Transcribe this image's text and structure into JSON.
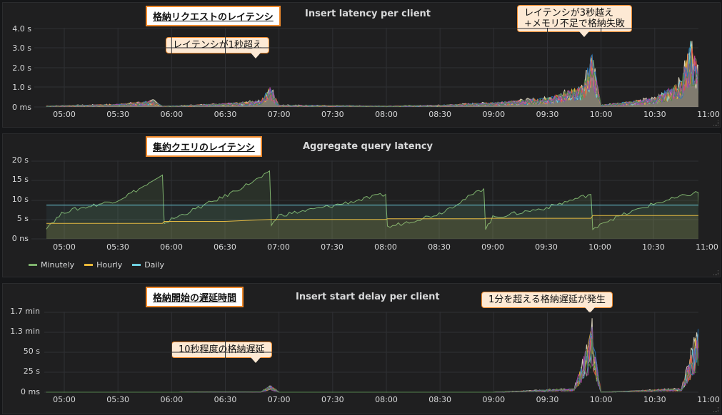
{
  "panels": [
    {
      "title": "Insert latency per client",
      "jp_label": "格納リクエストのレイテンシ",
      "callouts": [
        "レイテンシが1秒超え",
        "レイテンシが3秒越え\n+メモリ不足で格納失敗"
      ],
      "y_ticks": [
        "4.0 s",
        "3.0 s",
        "2.0 s",
        "1.0 s",
        "0 ms"
      ]
    },
    {
      "title": "Aggregate query latency",
      "jp_label": "集約クエリのレイテンシ",
      "y_ticks": [
        "20 s",
        "15 s",
        "10 s",
        "5 s",
        "0 ns"
      ]
    },
    {
      "title": "Insert start delay per client",
      "jp_label": "格納開始の遅延時間",
      "callouts": [
        "10秒程度の格納遅延",
        "1分を超える格納遅延が発生"
      ],
      "y_ticks": [
        "1.7 min",
        "1.3 min",
        "50 s",
        "25 s",
        "0 ms"
      ]
    }
  ],
  "x_ticks": [
    "05:00",
    "05:30",
    "06:00",
    "06:30",
    "07:00",
    "07:30",
    "08:00",
    "08:30",
    "09:00",
    "09:30",
    "10:00",
    "10:30",
    "11:00"
  ],
  "colors": {
    "minutely": "#7eb26d",
    "hourly": "#eab839",
    "daily": "#6ed0e0",
    "grid": "#2f3034",
    "panel_bg": "#1f1f20",
    "accent": "#f08a2c"
  },
  "chart_data": [
    {
      "type": "line",
      "title": "Insert latency per client",
      "x": [
        "04:50",
        "05:00",
        "05:30",
        "05:50",
        "05:55",
        "06:00",
        "06:30",
        "06:50",
        "06:55",
        "07:00",
        "07:30",
        "08:00",
        "08:30",
        "09:00",
        "09:30",
        "09:50",
        "09:55",
        "10:00",
        "10:30",
        "10:45",
        "10:50",
        "11:00"
      ],
      "series": [
        {
          "values": [
            0.05,
            0.08,
            0.15,
            0.35,
            0.05,
            0.05,
            0.2,
            0.35,
            1.2,
            0.1,
            0.08,
            0.05,
            0.1,
            0.25,
            0.5,
            1.2,
            3.1,
            0.1,
            0.5,
            1.5,
            3.7,
            0.2
          ]
        }
      ],
      "ylim": [
        0,
        4
      ],
      "y_unit": "s",
      "grid": true
    },
    {
      "type": "area",
      "title": "Aggregate query latency",
      "x": [
        "04:50",
        "05:00",
        "05:30",
        "05:55",
        "05:56",
        "06:00",
        "06:30",
        "06:55",
        "06:56",
        "07:00",
        "07:30",
        "08:00",
        "08:01",
        "08:30",
        "08:55",
        "08:56",
        "09:00",
        "09:30",
        "09:55",
        "09:56",
        "10:00",
        "10:30",
        "10:55",
        "10:56",
        "11:00"
      ],
      "series": [
        {
          "name": "Minutely",
          "values": [
            3,
            7,
            10,
            16,
            4,
            5,
            11,
            17,
            3.5,
            6,
            8.5,
            11.5,
            3,
            6.5,
            13,
            2.5,
            5.5,
            8,
            11.5,
            2,
            4,
            9,
            12,
            2,
            4
          ]
        },
        {
          "name": "Hourly",
          "values": [
            4,
            4,
            4,
            4,
            4.5,
            4.5,
            4.5,
            5,
            5,
            5,
            5,
            5,
            5.2,
            5.2,
            5.2,
            5.3,
            5.3,
            5.3,
            5.3,
            6,
            6,
            6,
            6,
            6,
            6
          ]
        },
        {
          "name": "Daily",
          "values": [
            8.7,
            8.7,
            8.7,
            8.7,
            8.7,
            8.7,
            8.7,
            8.7,
            8.7,
            8.7,
            8.7,
            8.7,
            8.7,
            8.7,
            8.7,
            8.7,
            8.7,
            8.7,
            8.7,
            8.7,
            8.7,
            8.7,
            8.7,
            8.7,
            8.7
          ]
        }
      ],
      "ylim": [
        0,
        20
      ],
      "y_unit": "s",
      "legend": "bottom-left",
      "grid": true
    },
    {
      "type": "line",
      "title": "Insert start delay per client",
      "x": [
        "04:50",
        "05:00",
        "06:00",
        "06:50",
        "06:55",
        "07:00",
        "08:00",
        "09:00",
        "09:45",
        "09:55",
        "10:00",
        "10:45",
        "10:55",
        "11:00"
      ],
      "series": [
        {
          "values": [
            0,
            0,
            0,
            0.5,
            10,
            0,
            0,
            0,
            5,
            90,
            0,
            5,
            95,
            0
          ]
        }
      ],
      "ylim": [
        0,
        102
      ],
      "y_unit": "s",
      "grid": true
    }
  ]
}
